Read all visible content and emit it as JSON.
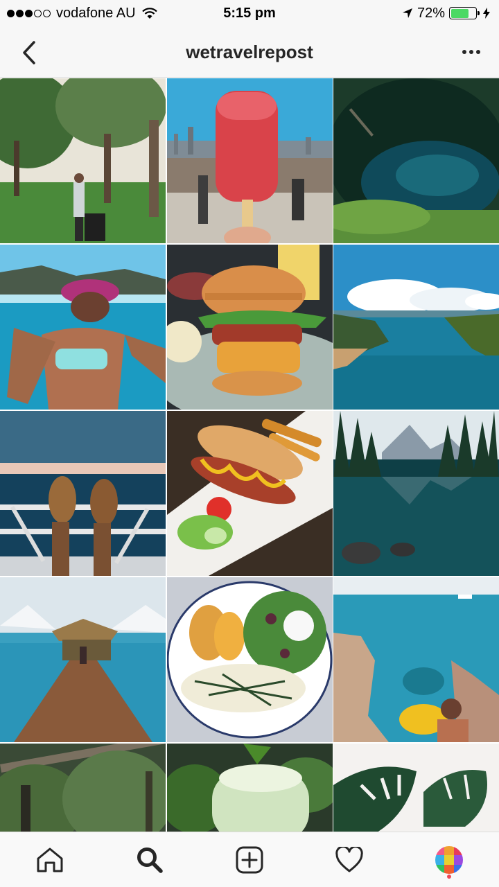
{
  "status_bar": {
    "carrier": "vodafone AU",
    "time": "5:15 pm",
    "battery_percent": "72%",
    "battery_level": 0.72,
    "signal_bars": 3,
    "signal_max": 5
  },
  "header": {
    "title": "wetravelrepost",
    "back_icon": "chevron-left-icon",
    "more_icon": "more-horizontal-icon"
  },
  "grid": {
    "tiles": [
      "park-traveler-photo",
      "popsicle-city-photo",
      "cenote-cave-photo",
      "underwater-swimmer-photo",
      "burger-photo",
      "turquoise-river-photo",
      "ship-railing-feet-photo",
      "hotdog-fries-photo",
      "mountain-lake-photo",
      "overwater-hut-pier-photo",
      "salad-fish-plate-photo",
      "rocky-coast-swimmer-photo",
      "forest-photo",
      "green-smoothie-photo",
      "monstera-plant-photo"
    ]
  },
  "tab_bar": {
    "items": [
      "home-icon",
      "search-icon",
      "add-post-icon",
      "heart-icon",
      "profile-avatar-icon"
    ],
    "active": "search-icon",
    "accent": "#ed4956"
  }
}
